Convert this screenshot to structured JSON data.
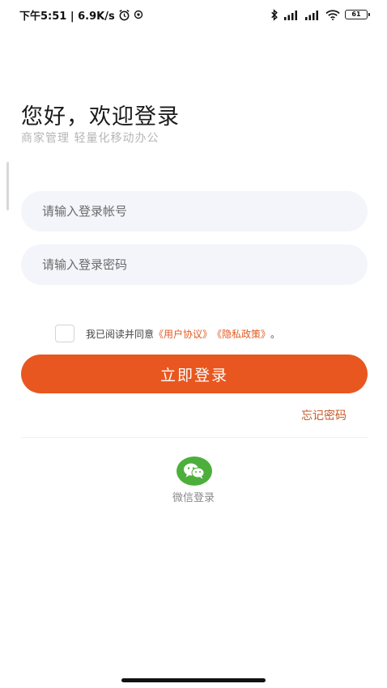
{
  "status_bar": {
    "time_speed": "下午5:51 | 6.9K/s",
    "battery": "61"
  },
  "header": {
    "greeting": "您好，欢迎登录",
    "subtitle": "商家管理 轻量化移动办公"
  },
  "form": {
    "account_placeholder": "请输入登录帐号",
    "password_placeholder": "请输入登录密码"
  },
  "agreement": {
    "prefix": "我已阅读并同意",
    "user_agreement": "《用户协议》",
    "privacy_policy": "《隐私政策》",
    "suffix": "。"
  },
  "actions": {
    "login_label": "立即登录",
    "forgot_label": "忘记密码"
  },
  "third_party": {
    "wechat_label": "微信登录"
  },
  "colors": {
    "accent": "#e8571f",
    "wechat": "#4caf3c"
  },
  "icons": [
    "alarm-icon",
    "notification-icon",
    "bluetooth-icon",
    "signal-icon",
    "wifi-icon",
    "battery-icon",
    "wechat-icon"
  ]
}
